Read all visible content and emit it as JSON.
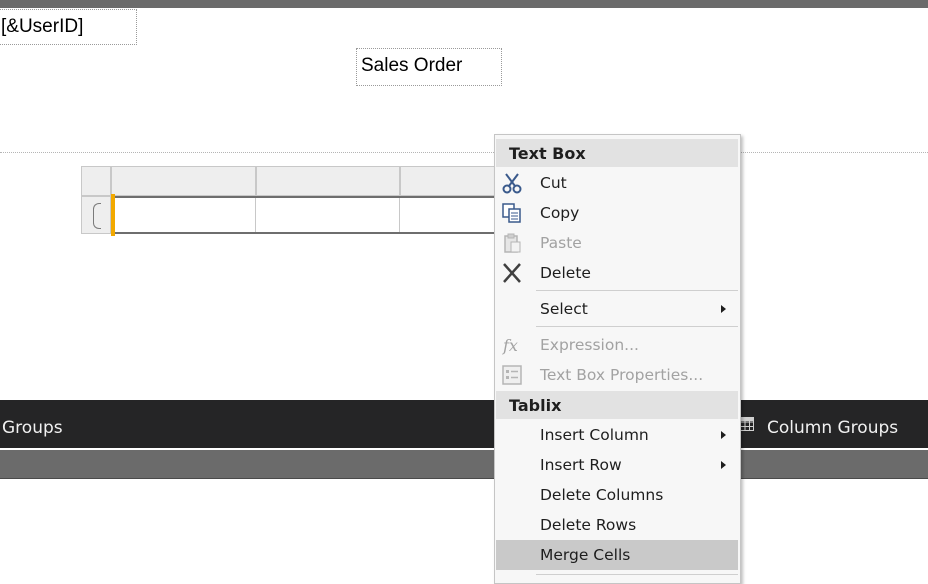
{
  "report": {
    "userid_text": "[&UserID]",
    "title_text": "Sales Order"
  },
  "grouping": {
    "row_groups_label": "Groups",
    "column_groups_label": "Column Groups"
  },
  "context_menu": {
    "section_textbox": "Text Box",
    "items_textbox": [
      {
        "label": "Cut",
        "icon": "cut-icon",
        "enabled": true
      },
      {
        "label": "Copy",
        "icon": "copy-icon",
        "enabled": true
      },
      {
        "label": "Paste",
        "icon": "paste-icon",
        "enabled": false
      },
      {
        "label": "Delete",
        "icon": "delete-icon",
        "enabled": true
      },
      {
        "label": "Select",
        "icon": "",
        "enabled": true,
        "submenu": true
      },
      {
        "label": "Expression...",
        "icon": "expression-icon",
        "enabled": false
      },
      {
        "label": "Text Box Properties...",
        "icon": "properties-icon",
        "enabled": false
      }
    ],
    "section_tablix": "Tablix",
    "items_tablix": [
      {
        "label": "Insert Column",
        "enabled": true,
        "submenu": true
      },
      {
        "label": "Insert Row",
        "enabled": true,
        "submenu": true
      },
      {
        "label": "Delete Columns",
        "enabled": true
      },
      {
        "label": "Delete Rows",
        "enabled": true
      },
      {
        "label": "Merge Cells",
        "enabled": true,
        "highlighted": true
      }
    ]
  },
  "colors": {
    "selection_handle": "#f2a900",
    "group_pane_bg": "#252526",
    "menu_highlight": "#c9c9c9"
  }
}
